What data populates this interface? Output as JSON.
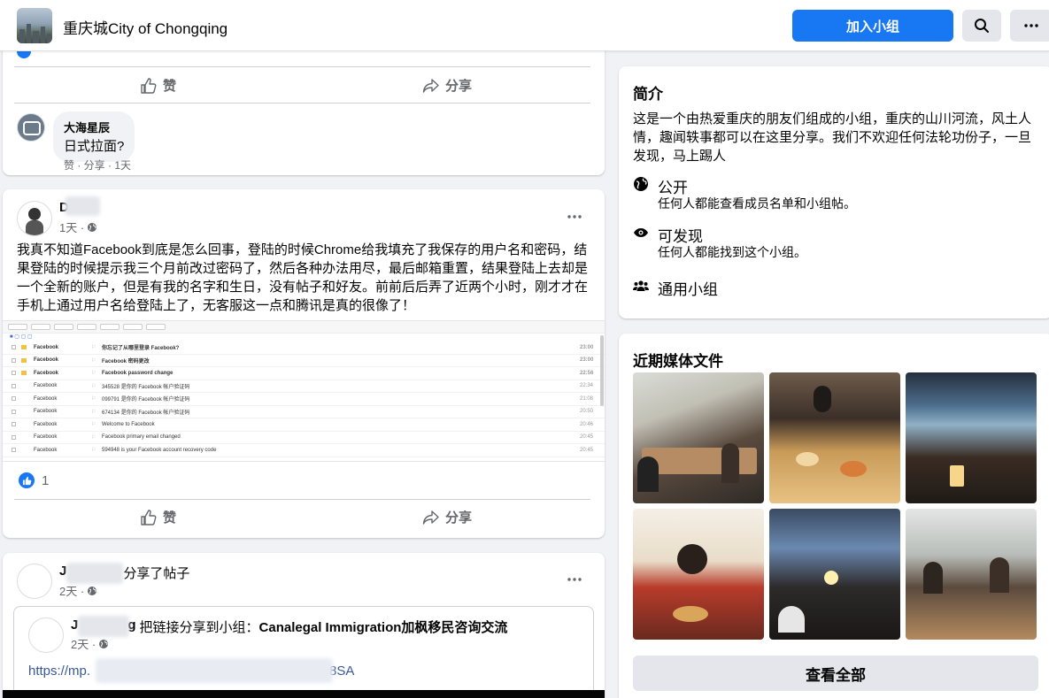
{
  "header": {
    "group_name": "重庆城City of Chongqing",
    "join_label": "加入小组"
  },
  "post1": {
    "like_label": "赞",
    "share_label": "分享",
    "comment": {
      "author": "大海星辰",
      "text": "日式拉面?",
      "links": "赞 · 分享 · 1天"
    }
  },
  "post2": {
    "author": "D",
    "time": "1天 ·",
    "text": "我真不知道Facebook到底是怎么回事，登陆的时候Chrome给我填充了我保存的用户名和密码，结果登陆的时候提示我三个月前改过密码了，然后各种办法用尽，最后邮箱重置，结果登陆上去却是一个全新的账户，但是有我的名字和生日，没有帖子和好友。前前后后弄了近两个小时，刚才才在手机上通过用户名给登陆上了，无客服这一点和腾讯是真的很像了！",
    "screenshot": {
      "emails": [
        {
          "from": "Facebook",
          "subject": "你忘记了从哪里登录 Facebook?",
          "time": "23:00",
          "unread": true
        },
        {
          "from": "Facebook",
          "subject": "Facebook 密码更改",
          "time": "23:00",
          "unread": true
        },
        {
          "from": "Facebook",
          "subject": "Facebook password change",
          "time": "22:56",
          "unread": true
        },
        {
          "from": "Facebook",
          "subject": "345528 是你的 Facebook 帐户验证码",
          "time": "22:34",
          "unread": false
        },
        {
          "from": "Facebook",
          "subject": "099791 是你的 Facebook 帐户验证码",
          "time": "21:08",
          "unread": false
        },
        {
          "from": "Facebook",
          "subject": "674134 是你的 Facebook 帐户验证码",
          "time": "20:50",
          "unread": false
        },
        {
          "from": "Facebook",
          "subject": "Welcome to Facebook",
          "time": "20:46",
          "unread": false
        },
        {
          "from": "Facebook",
          "subject": "Facebook primary email changed",
          "time": "20:45",
          "unread": false
        },
        {
          "from": "Facebook",
          "subject": "594948 is your Facebook account recovery code",
          "time": "20:45",
          "unread": false
        }
      ]
    },
    "like_count": "1",
    "like_label": "赞",
    "share_label": "分享"
  },
  "post3": {
    "author": "J",
    "action": "分享了帖子",
    "time": "2天 ·",
    "shared": {
      "author": "J",
      "author_suffix": "g",
      "action": "把链接分享到小组：",
      "group": "Canalegal Immigration加枫移民咨询交流",
      "time": "2天 ·",
      "link_start": "https://mp.",
      "link_end": "8SA"
    }
  },
  "about": {
    "title": "简介",
    "description": "这是一个由热爱重庆的朋友们组成的小组，重庆的山川河流，风土人情，趣闻轶事都可以在这里分享。我们不欢迎任何法轮功份子，一旦发现，马上踢人",
    "public_title": "公开",
    "public_sub": "任何人都能查看成员名单和小组帖。",
    "visible_title": "可发现",
    "visible_sub": "任何人都能找到这个小组。",
    "type_title": "通用小组"
  },
  "media": {
    "title": "近期媒体文件",
    "see_all": "查看全部"
  },
  "colors": {
    "brand_blue": "#1877f2",
    "page_bg": "#f0f2f5",
    "secondary_text": "#65676b"
  }
}
